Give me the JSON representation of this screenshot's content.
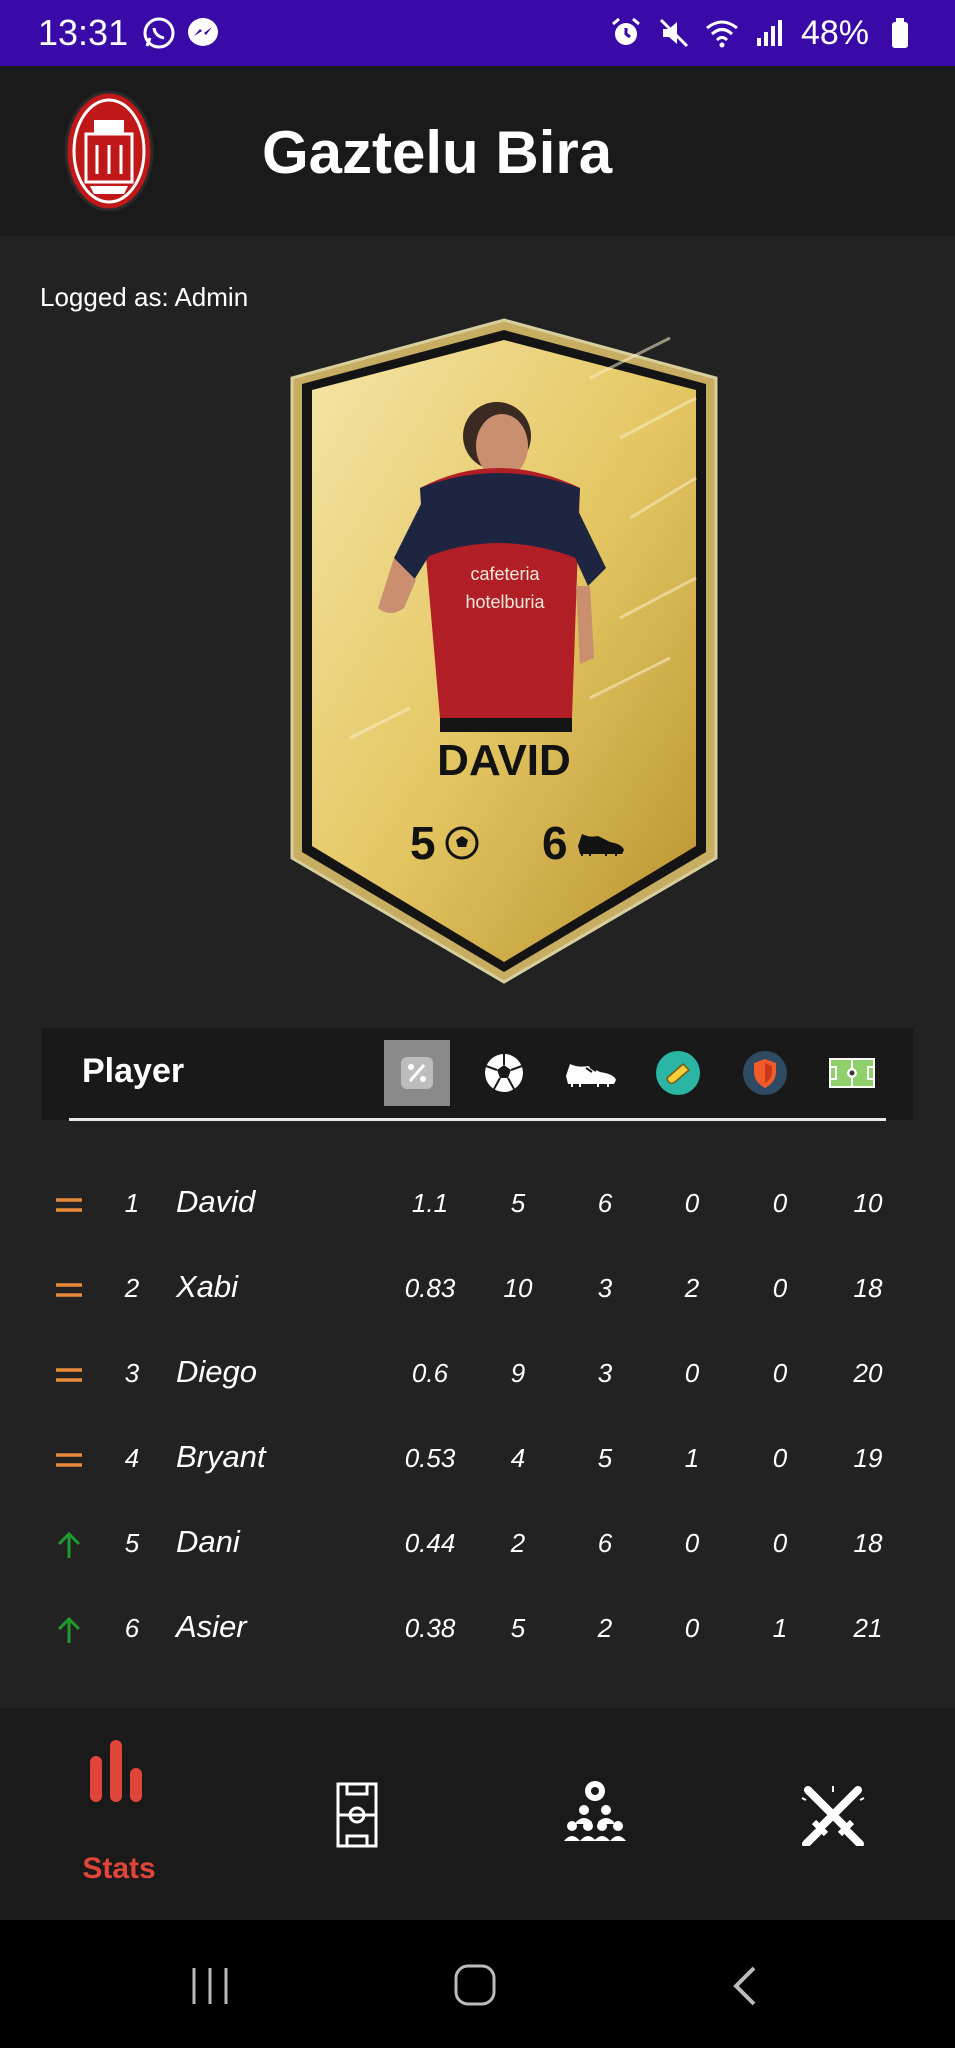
{
  "status_bar": {
    "time": "13:31",
    "battery": "48%",
    "left_icons": [
      "whatsapp-icon",
      "messenger-icon"
    ],
    "right_icons": [
      "alarm-icon",
      "mute-icon",
      "wifi-icon",
      "signal-icon",
      "battery-icon"
    ]
  },
  "app": {
    "title": "Gaztelu Bira",
    "logged_as": "Logged as: Admin"
  },
  "card": {
    "name": "DAVID",
    "goals": "5",
    "assists": "6"
  },
  "table": {
    "header_label": "Player",
    "column_icons": [
      "percent-icon",
      "ball-icon",
      "boot-icon",
      "whistle-icon",
      "shield-icon",
      "pitch-icon"
    ],
    "active_column": "percent-icon",
    "rows": [
      {
        "trend": "equal",
        "rank": "1",
        "name": "David",
        "values": [
          "1.1",
          "5",
          "6",
          "0",
          "0",
          "10"
        ]
      },
      {
        "trend": "equal",
        "rank": "2",
        "name": "Xabi",
        "values": [
          "0.83",
          "10",
          "3",
          "2",
          "0",
          "18"
        ]
      },
      {
        "trend": "equal",
        "rank": "3",
        "name": "Diego",
        "values": [
          "0.6",
          "9",
          "3",
          "0",
          "0",
          "20"
        ]
      },
      {
        "trend": "equal",
        "rank": "4",
        "name": "Bryant",
        "values": [
          "0.53",
          "4",
          "5",
          "1",
          "0",
          "19"
        ]
      },
      {
        "trend": "up",
        "rank": "5",
        "name": "Dani",
        "values": [
          "0.44",
          "2",
          "6",
          "0",
          "0",
          "18"
        ]
      },
      {
        "trend": "up",
        "rank": "6",
        "name": "Asier",
        "values": [
          "0.38",
          "5",
          "2",
          "0",
          "1",
          "21"
        ]
      }
    ]
  },
  "bottom_nav": {
    "items": [
      {
        "icon": "bar-chart-icon",
        "label": "Stats",
        "active": true
      },
      {
        "icon": "field-icon",
        "label": "",
        "active": false
      },
      {
        "icon": "team-icon",
        "label": "",
        "active": false
      },
      {
        "icon": "crossed-swords-icon",
        "label": "",
        "active": false
      }
    ]
  },
  "colors": {
    "status_bar": "#3a0aa8",
    "accent": "#e0453a",
    "trend_equal": "#e8893a",
    "trend_up": "#1f9a2c",
    "card_gold": "#e8cf72"
  }
}
